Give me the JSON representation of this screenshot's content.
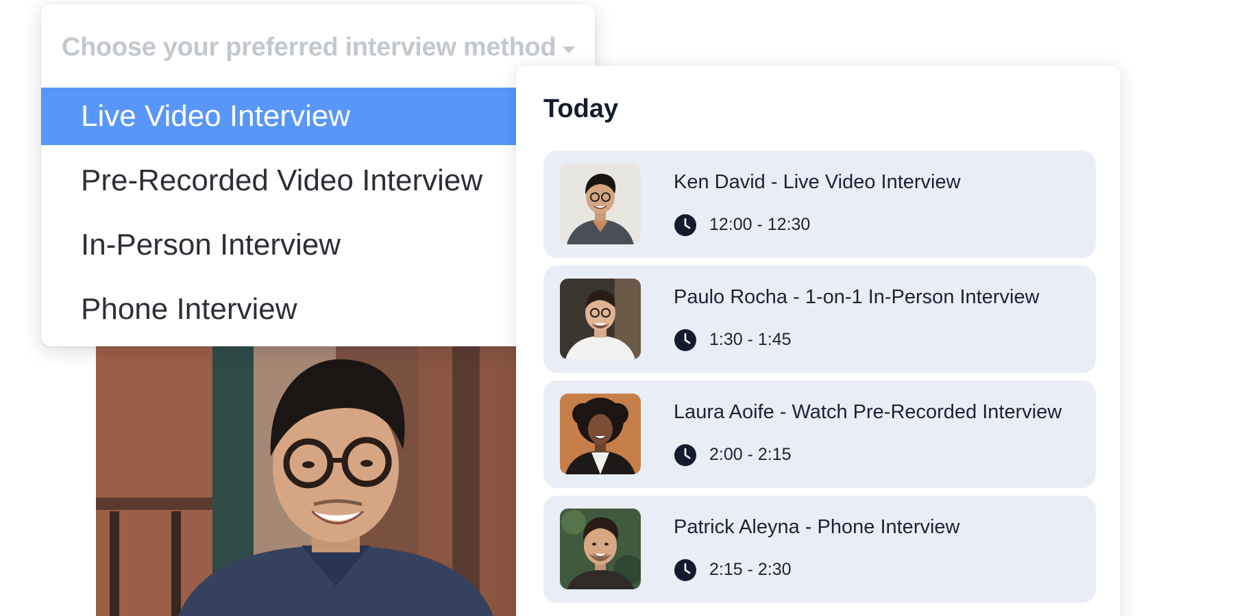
{
  "dropdown": {
    "placeholder": "Choose your preferred interview method",
    "selected_index": 0,
    "options": [
      "Live Video Interview",
      "Pre-Recorded Video Interview",
      "In-Person Interview",
      "Phone Interview"
    ]
  },
  "schedule": {
    "title": "Today",
    "items": [
      {
        "title": "Ken David - Live Video Interview",
        "time": "12:00 - 12:30"
      },
      {
        "title": "Paulo Rocha - 1-on-1 In-Person Interview",
        "time": "1:30 - 1:45"
      },
      {
        "title": "Laura Aoife - Watch Pre-Recorded Interview",
        "time": "2:00 - 2:15"
      },
      {
        "title": "Patrick Aleyna - Phone Interview",
        "time": "2:15 - 2:30"
      }
    ]
  },
  "colors": {
    "accent": "#5896f9",
    "card_background": "#e9edf6",
    "placeholder_text": "#c3c8cd",
    "heading_text": "#141b2e"
  },
  "icons": {
    "dropdown_caret": "caret-down-icon",
    "time": "clock-icon"
  }
}
